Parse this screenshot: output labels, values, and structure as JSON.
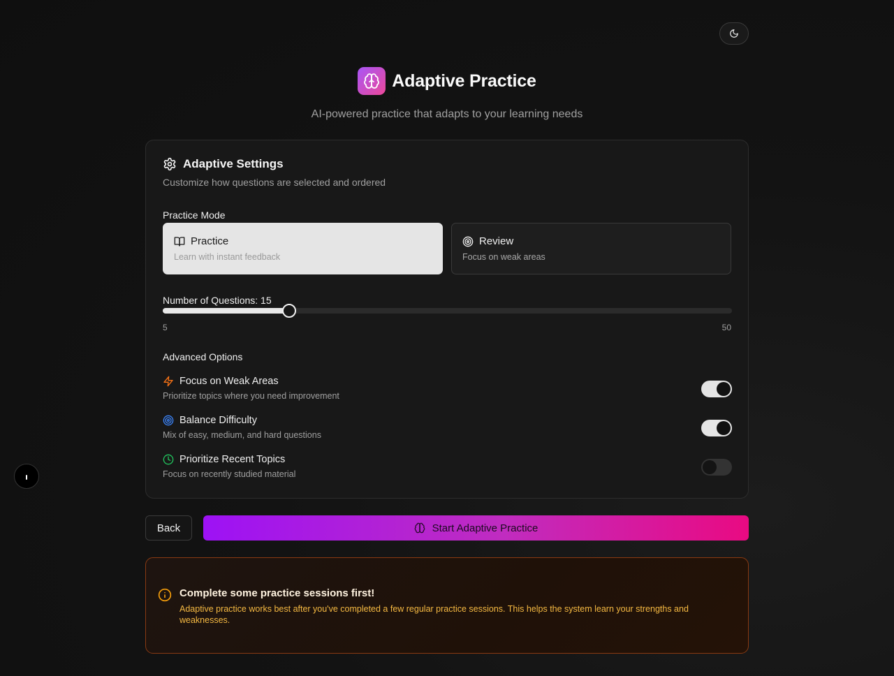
{
  "header": {
    "title": "Adaptive Practice",
    "subtitle": "AI-powered practice that adapts to your learning needs"
  },
  "settings": {
    "title": "Adaptive Settings",
    "description": "Customize how questions are selected and ordered",
    "mode_label": "Practice Mode",
    "modes": [
      {
        "label": "Practice",
        "description": "Learn with instant feedback",
        "selected": true,
        "icon": "book-open-icon"
      },
      {
        "label": "Review",
        "description": "Focus on weak areas",
        "selected": false,
        "icon": "target-icon"
      }
    ],
    "questions": {
      "label": "Number of Questions: 15",
      "value": 15,
      "min": 5,
      "max": 50,
      "min_label": "5",
      "max_label": "50"
    },
    "advanced_label": "Advanced Options",
    "options": [
      {
        "label": "Focus on Weak Areas",
        "description": "Prioritize topics where you need improvement",
        "enabled": true,
        "icon": "zap-icon",
        "color": "#f97316"
      },
      {
        "label": "Balance Difficulty",
        "description": "Mix of easy, medium, and hard questions",
        "enabled": true,
        "icon": "target-icon",
        "color": "#3b82f6"
      },
      {
        "label": "Prioritize Recent Topics",
        "description": "Focus on recently studied material",
        "enabled": false,
        "icon": "clock-icon",
        "color": "#22c55e"
      }
    ]
  },
  "actions": {
    "back_label": "Back",
    "start_label": "Start Adaptive Practice"
  },
  "alert": {
    "title": "Complete some practice sessions first!",
    "body": "Adaptive practice works best after you've completed a few regular practice sessions. This helps the system learn your strengths and weaknesses."
  },
  "colors": {
    "brand_gradient_start": "#9d12f5",
    "brand_gradient_end": "#e90a82",
    "alert_border": "#8a3a12",
    "alert_text": "#f5b942"
  }
}
